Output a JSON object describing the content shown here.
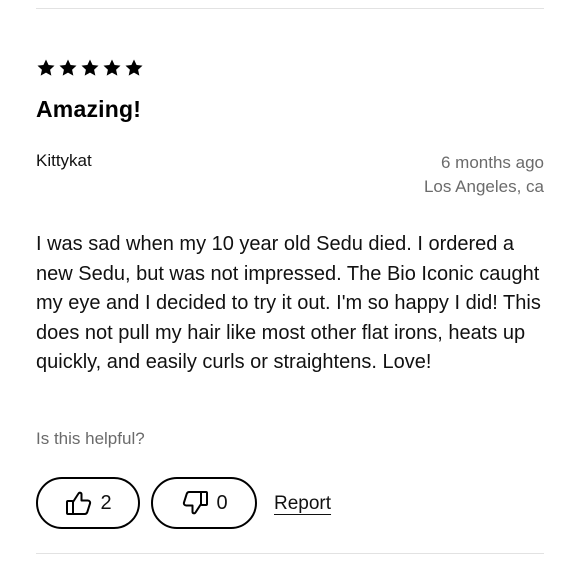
{
  "review": {
    "rating": 5,
    "rating_max": 5,
    "title": "Amazing!",
    "author": "Kittykat",
    "time_ago": "6 months ago",
    "location": "Los Angeles, ca",
    "body": "I was sad when my 10 year old Sedu died. I ordered a new Sedu, but was not impressed. The Bio Iconic caught my eye and I decided to try it out. I'm so happy I did! This does not pull my hair like most other flat irons, heats up quickly, and easily curls or straightens. Love!"
  },
  "feedback": {
    "prompt": "Is this helpful?",
    "helpful_count": "2",
    "unhelpful_count": "0",
    "report_label": "Report"
  },
  "icons": {
    "star": "star-icon",
    "thumbs_up": "thumbs-up-icon",
    "thumbs_down": "thumbs-down-icon"
  }
}
